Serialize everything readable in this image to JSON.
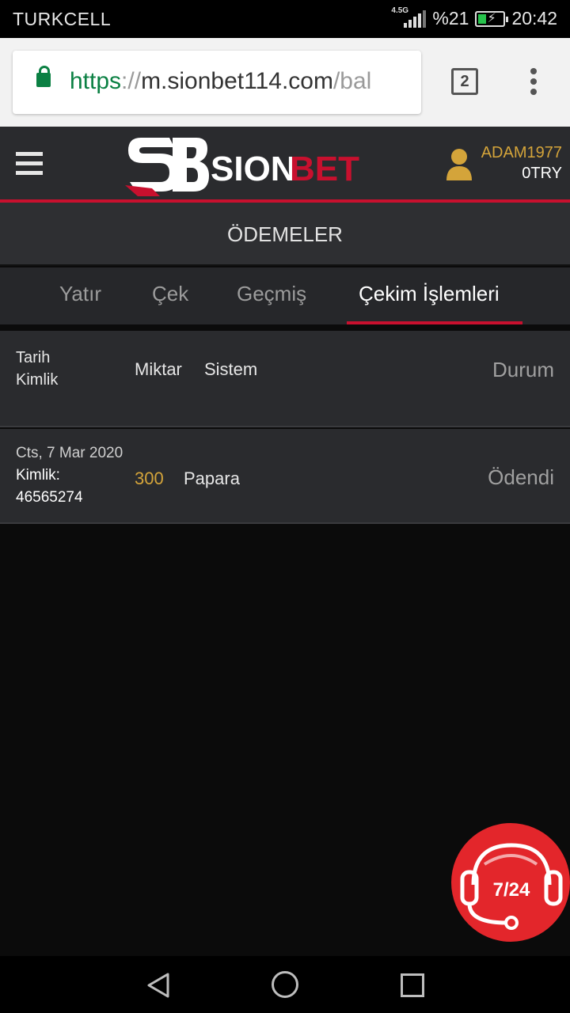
{
  "status_bar": {
    "carrier": "TURKCELL",
    "network": "4.5G",
    "battery": "%21",
    "time": "20:42"
  },
  "browser": {
    "url_scheme": "https",
    "url_sep": "://",
    "url_host": "m.sionbet114.com",
    "url_path": "/bal",
    "tab_count": "2",
    "lock_icon": "lock-icon",
    "menu_icon": "more-vert-icon"
  },
  "header": {
    "menu_icon": "hamburger-icon",
    "logo_text_1": "SION",
    "logo_text_2": "BET",
    "username": "ADAM1977",
    "balance": "0TRY",
    "brand_red": "#c8102e",
    "gold": "#d4a43a"
  },
  "page_title": "ÖDEMELER",
  "tabs": [
    {
      "label": "Yatır",
      "active": false
    },
    {
      "label": "Çek",
      "active": false
    },
    {
      "label": "Geçmiş",
      "active": false
    },
    {
      "label": "Çekim İşlemleri",
      "active": true
    }
  ],
  "table": {
    "headers": {
      "date": "Tarih",
      "id": "Kimlik",
      "amount": "Miktar",
      "system": "Sistem",
      "status": "Durum"
    },
    "rows": [
      {
        "date": "Cts, 7 Mar 2020",
        "id_label": "Kimlik:",
        "id_value": "46565274",
        "amount": "300",
        "system": "Papara",
        "status": "Ödendi"
      }
    ]
  },
  "support": {
    "label": "7/24",
    "icon": "headset-icon"
  },
  "android_nav": {
    "back": "back-icon",
    "home": "home-icon",
    "recents": "recents-icon"
  }
}
